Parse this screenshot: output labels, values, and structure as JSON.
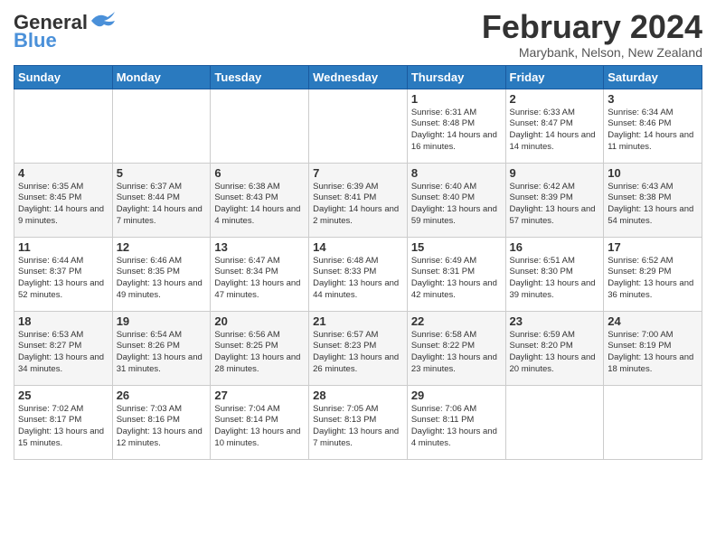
{
  "logo": {
    "line1": "General",
    "line2": "Blue"
  },
  "title": "February 2024",
  "location": "Marybank, Nelson, New Zealand",
  "days_header": [
    "Sunday",
    "Monday",
    "Tuesday",
    "Wednesday",
    "Thursday",
    "Friday",
    "Saturday"
  ],
  "weeks": [
    [
      {
        "day": "",
        "info": ""
      },
      {
        "day": "",
        "info": ""
      },
      {
        "day": "",
        "info": ""
      },
      {
        "day": "",
        "info": ""
      },
      {
        "day": "1",
        "info": "Sunrise: 6:31 AM\nSunset: 8:48 PM\nDaylight: 14 hours and 16 minutes."
      },
      {
        "day": "2",
        "info": "Sunrise: 6:33 AM\nSunset: 8:47 PM\nDaylight: 14 hours and 14 minutes."
      },
      {
        "day": "3",
        "info": "Sunrise: 6:34 AM\nSunset: 8:46 PM\nDaylight: 14 hours and 11 minutes."
      }
    ],
    [
      {
        "day": "4",
        "info": "Sunrise: 6:35 AM\nSunset: 8:45 PM\nDaylight: 14 hours and 9 minutes."
      },
      {
        "day": "5",
        "info": "Sunrise: 6:37 AM\nSunset: 8:44 PM\nDaylight: 14 hours and 7 minutes."
      },
      {
        "day": "6",
        "info": "Sunrise: 6:38 AM\nSunset: 8:43 PM\nDaylight: 14 hours and 4 minutes."
      },
      {
        "day": "7",
        "info": "Sunrise: 6:39 AM\nSunset: 8:41 PM\nDaylight: 14 hours and 2 minutes."
      },
      {
        "day": "8",
        "info": "Sunrise: 6:40 AM\nSunset: 8:40 PM\nDaylight: 13 hours and 59 minutes."
      },
      {
        "day": "9",
        "info": "Sunrise: 6:42 AM\nSunset: 8:39 PM\nDaylight: 13 hours and 57 minutes."
      },
      {
        "day": "10",
        "info": "Sunrise: 6:43 AM\nSunset: 8:38 PM\nDaylight: 13 hours and 54 minutes."
      }
    ],
    [
      {
        "day": "11",
        "info": "Sunrise: 6:44 AM\nSunset: 8:37 PM\nDaylight: 13 hours and 52 minutes."
      },
      {
        "day": "12",
        "info": "Sunrise: 6:46 AM\nSunset: 8:35 PM\nDaylight: 13 hours and 49 minutes."
      },
      {
        "day": "13",
        "info": "Sunrise: 6:47 AM\nSunset: 8:34 PM\nDaylight: 13 hours and 47 minutes."
      },
      {
        "day": "14",
        "info": "Sunrise: 6:48 AM\nSunset: 8:33 PM\nDaylight: 13 hours and 44 minutes."
      },
      {
        "day": "15",
        "info": "Sunrise: 6:49 AM\nSunset: 8:31 PM\nDaylight: 13 hours and 42 minutes."
      },
      {
        "day": "16",
        "info": "Sunrise: 6:51 AM\nSunset: 8:30 PM\nDaylight: 13 hours and 39 minutes."
      },
      {
        "day": "17",
        "info": "Sunrise: 6:52 AM\nSunset: 8:29 PM\nDaylight: 13 hours and 36 minutes."
      }
    ],
    [
      {
        "day": "18",
        "info": "Sunrise: 6:53 AM\nSunset: 8:27 PM\nDaylight: 13 hours and 34 minutes."
      },
      {
        "day": "19",
        "info": "Sunrise: 6:54 AM\nSunset: 8:26 PM\nDaylight: 13 hours and 31 minutes."
      },
      {
        "day": "20",
        "info": "Sunrise: 6:56 AM\nSunset: 8:25 PM\nDaylight: 13 hours and 28 minutes."
      },
      {
        "day": "21",
        "info": "Sunrise: 6:57 AM\nSunset: 8:23 PM\nDaylight: 13 hours and 26 minutes."
      },
      {
        "day": "22",
        "info": "Sunrise: 6:58 AM\nSunset: 8:22 PM\nDaylight: 13 hours and 23 minutes."
      },
      {
        "day": "23",
        "info": "Sunrise: 6:59 AM\nSunset: 8:20 PM\nDaylight: 13 hours and 20 minutes."
      },
      {
        "day": "24",
        "info": "Sunrise: 7:00 AM\nSunset: 8:19 PM\nDaylight: 13 hours and 18 minutes."
      }
    ],
    [
      {
        "day": "25",
        "info": "Sunrise: 7:02 AM\nSunset: 8:17 PM\nDaylight: 13 hours and 15 minutes."
      },
      {
        "day": "26",
        "info": "Sunrise: 7:03 AM\nSunset: 8:16 PM\nDaylight: 13 hours and 12 minutes."
      },
      {
        "day": "27",
        "info": "Sunrise: 7:04 AM\nSunset: 8:14 PM\nDaylight: 13 hours and 10 minutes."
      },
      {
        "day": "28",
        "info": "Sunrise: 7:05 AM\nSunset: 8:13 PM\nDaylight: 13 hours and 7 minutes."
      },
      {
        "day": "29",
        "info": "Sunrise: 7:06 AM\nSunset: 8:11 PM\nDaylight: 13 hours and 4 minutes."
      },
      {
        "day": "",
        "info": ""
      },
      {
        "day": "",
        "info": ""
      }
    ]
  ]
}
